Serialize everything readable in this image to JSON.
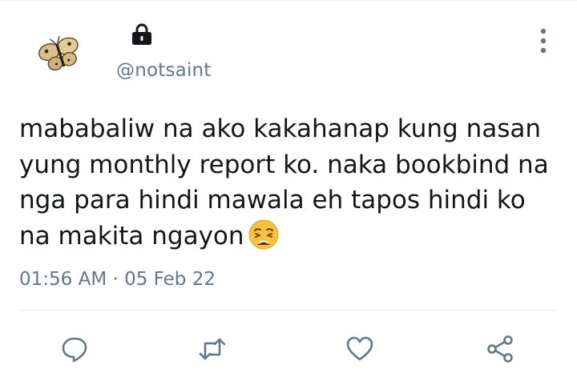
{
  "tweet": {
    "handle": "@notsaint",
    "text": "mababaliw na ako kakahanap kung nasan\nyung monthly report ko. naka bookbind na\nnga para hindi mawala eh tapos hindi ko\nna makita ngayon",
    "emoji": "weary-face",
    "time": "01:56 AM",
    "separator": " · ",
    "date": "05 Feb 22",
    "protected_account": true
  },
  "actions": {
    "reply_icon": "reply-icon",
    "retweet_icon": "retweet-icon",
    "like_icon": "heart-icon",
    "share_icon": "share-icon",
    "more_icon": "more-vertical-icon"
  },
  "colors": {
    "text": "#14171a",
    "secondary": "#657786",
    "action_icon": "#657786",
    "divider": "#e6ecf0",
    "emoji_face": "#f6c23e"
  }
}
